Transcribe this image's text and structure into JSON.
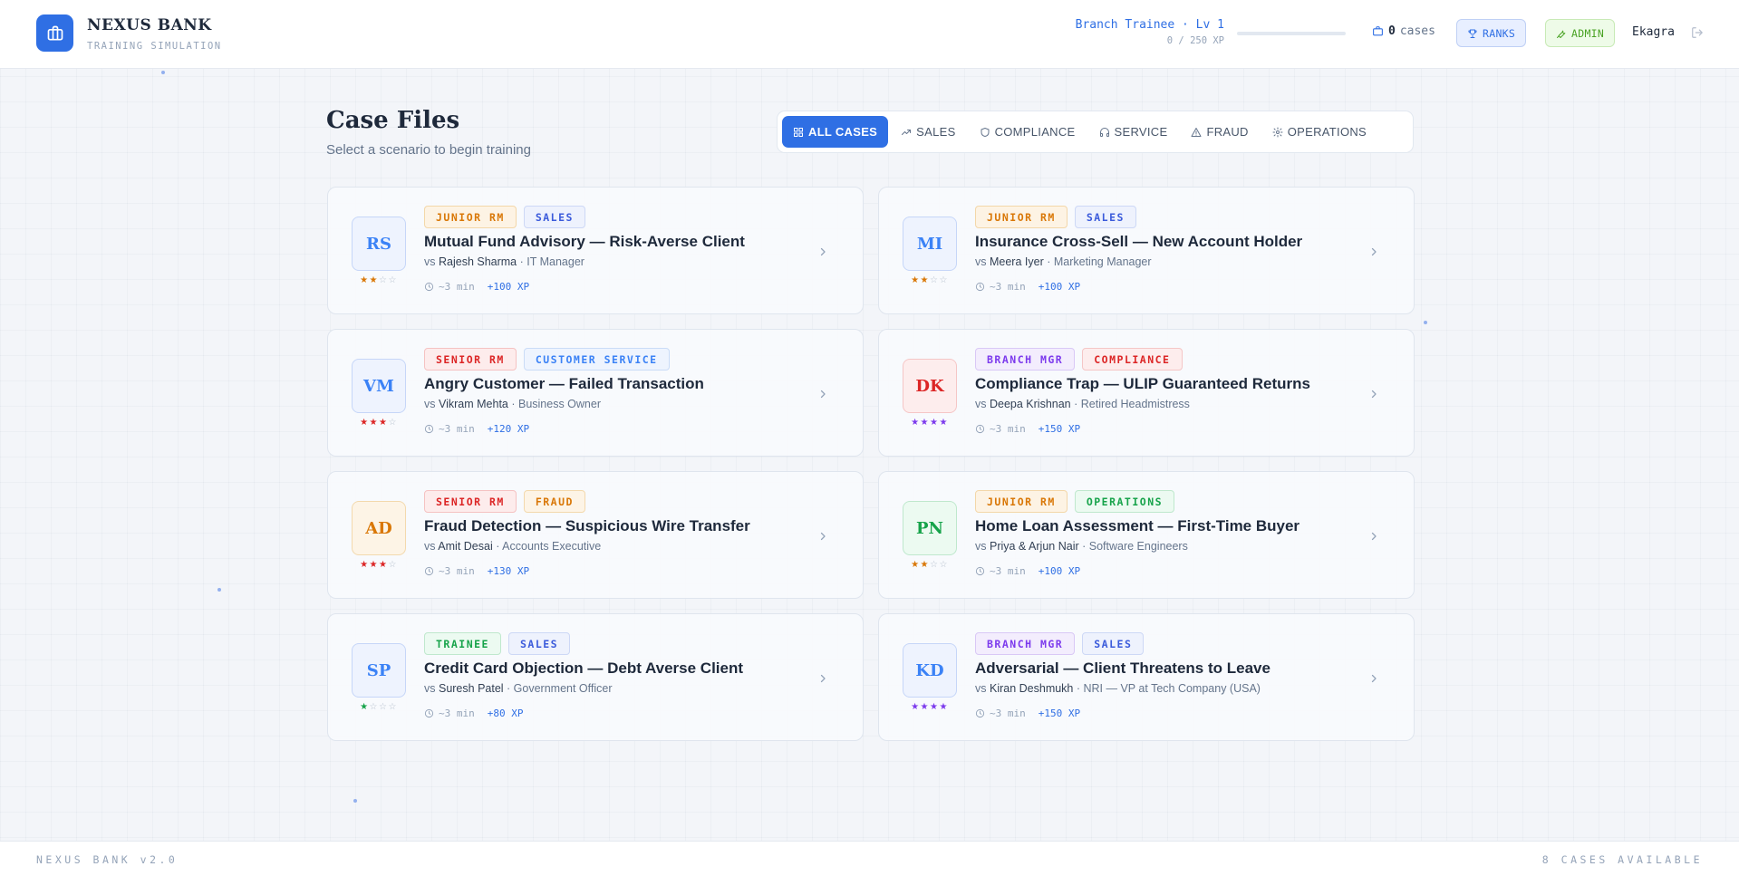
{
  "header": {
    "brand_title": "NEXUS BANK",
    "brand_subtitle": "TRAINING SIMULATION",
    "rank_title": "Branch Trainee · Lv 1",
    "xp_text": "0 / 250 XP",
    "xp_progress_percent": 0,
    "cases_count": "0",
    "cases_label": "cases",
    "ranks_label": "RANKS",
    "admin_label": "ADMIN",
    "user_name": "Ekagra",
    "accent_color": "#2f6fe4"
  },
  "main": {
    "title": "Case Files",
    "subtitle": "Select a scenario to begin training",
    "filters": [
      {
        "label": "ALL CASES",
        "icon": "grid-icon",
        "active": true
      },
      {
        "label": "SALES",
        "icon": "trending-up-icon",
        "active": false
      },
      {
        "label": "COMPLIANCE",
        "icon": "shield-icon",
        "active": false
      },
      {
        "label": "SERVICE",
        "icon": "headphones-icon",
        "active": false
      },
      {
        "label": "FRAUD",
        "icon": "alert-triangle-icon",
        "active": false
      },
      {
        "label": "OPERATIONS",
        "icon": "gear-icon",
        "active": false
      }
    ],
    "cases": [
      {
        "initials": "RS",
        "avatar_color": "#3b82f6",
        "avatar_bg": "#eef3fe",
        "avatar_border": "#c6d6f8",
        "level": "JUNIOR RM",
        "level_color": "#d97706",
        "level_bg": "#fdf3e4",
        "level_border": "#f3d7a9",
        "category": "SALES",
        "category_color": "#3b5bdb",
        "category_bg": "#eef2fd",
        "category_border": "#cdd8f6",
        "title": "Mutual Fund Advisory — Risk-Averse Client",
        "vs": "vs",
        "client": "Rajesh Sharma",
        "role": " · IT Manager",
        "duration": "~3 min",
        "xp": "+100 XP",
        "stars": 2,
        "star_color": "#d97706"
      },
      {
        "initials": "MI",
        "avatar_color": "#3b82f6",
        "avatar_bg": "#eef3fe",
        "avatar_border": "#c6d6f8",
        "level": "JUNIOR RM",
        "level_color": "#d97706",
        "level_bg": "#fdf3e4",
        "level_border": "#f3d7a9",
        "category": "SALES",
        "category_color": "#3b5bdb",
        "category_bg": "#eef2fd",
        "category_border": "#cdd8f6",
        "title": "Insurance Cross-Sell — New Account Holder",
        "vs": "vs",
        "client": "Meera Iyer",
        "role": " · Marketing Manager",
        "duration": "~3 min",
        "xp": "+100 XP",
        "stars": 2,
        "star_color": "#d97706"
      },
      {
        "initials": "VM",
        "avatar_color": "#3b82f6",
        "avatar_bg": "#eef3fe",
        "avatar_border": "#c6d6f8",
        "level": "SENIOR RM",
        "level_color": "#dc2626",
        "level_bg": "#fdecec",
        "level_border": "#f5c2c2",
        "category": "CUSTOMER SERVICE",
        "category_color": "#3b82f6",
        "category_bg": "#eef4fe",
        "category_border": "#cadcf7",
        "title": "Angry Customer — Failed Transaction",
        "vs": "vs",
        "client": "Vikram Mehta",
        "role": " · Business Owner",
        "duration": "~3 min",
        "xp": "+120 XP",
        "stars": 3,
        "star_color": "#dc2626"
      },
      {
        "initials": "DK",
        "avatar_color": "#dc2626",
        "avatar_bg": "#fdeded",
        "avatar_border": "#f5c6c6",
        "level": "BRANCH MGR",
        "level_color": "#7c3aed",
        "level_bg": "#f3edfd",
        "level_border": "#d9c8f6",
        "category": "COMPLIANCE",
        "category_color": "#dc2626",
        "category_bg": "#fdeded",
        "category_border": "#f5c6c6",
        "title": "Compliance Trap — ULIP Guaranteed Returns",
        "vs": "vs",
        "client": "Deepa Krishnan",
        "role": " · Retired Headmistress",
        "duration": "~3 min",
        "xp": "+150 XP",
        "stars": 4,
        "star_color": "#7c3aed"
      },
      {
        "initials": "AD",
        "avatar_color": "#d97706",
        "avatar_bg": "#fdf4e6",
        "avatar_border": "#f3d9ad",
        "level": "SENIOR RM",
        "level_color": "#dc2626",
        "level_bg": "#fdecec",
        "level_border": "#f5c2c2",
        "category": "FRAUD",
        "category_color": "#d97706",
        "category_bg": "#fdf4e6",
        "category_border": "#f3d9ad",
        "title": "Fraud Detection — Suspicious Wire Transfer",
        "vs": "vs",
        "client": "Amit Desai",
        "role": " · Accounts Executive",
        "duration": "~3 min",
        "xp": "+130 XP",
        "stars": 3,
        "star_color": "#dc2626"
      },
      {
        "initials": "PN",
        "avatar_color": "#16a34a",
        "avatar_bg": "#ecfaf1",
        "avatar_border": "#bfe8cd",
        "level": "JUNIOR RM",
        "level_color": "#d97706",
        "level_bg": "#fdf3e4",
        "level_border": "#f3d7a9",
        "category": "OPERATIONS",
        "category_color": "#16a34a",
        "category_bg": "#ecfaf1",
        "category_border": "#bfe8cd",
        "title": "Home Loan Assessment — First-Time Buyer",
        "vs": "vs",
        "client": "Priya & Arjun Nair",
        "role": " · Software Engineers",
        "duration": "~3 min",
        "xp": "+100 XP",
        "stars": 2,
        "star_color": "#d97706"
      },
      {
        "initials": "SP",
        "avatar_color": "#3b82f6",
        "avatar_bg": "#eef3fe",
        "avatar_border": "#c6d6f8",
        "level": "TRAINEE",
        "level_color": "#16a34a",
        "level_bg": "#ecfaf1",
        "level_border": "#bfe8cd",
        "category": "SALES",
        "category_color": "#3b5bdb",
        "category_bg": "#eef2fd",
        "category_border": "#cdd8f6",
        "title": "Credit Card Objection — Debt Averse Client",
        "vs": "vs",
        "client": "Suresh Patel",
        "role": " · Government Officer",
        "duration": "~3 min",
        "xp": "+80 XP",
        "stars": 1,
        "star_color": "#16a34a"
      },
      {
        "initials": "KD",
        "avatar_color": "#3b82f6",
        "avatar_bg": "#eef3fe",
        "avatar_border": "#c6d6f8",
        "level": "BRANCH MGR",
        "level_color": "#7c3aed",
        "level_bg": "#f3edfd",
        "level_border": "#d9c8f6",
        "category": "SALES",
        "category_color": "#3b5bdb",
        "category_bg": "#eef2fd",
        "category_border": "#cdd8f6",
        "title": "Adversarial — Client Threatens to Leave",
        "vs": "vs",
        "client": "Kiran Deshmukh",
        "role": " · NRI — VP at Tech Company (USA)",
        "duration": "~3 min",
        "xp": "+150 XP",
        "stars": 4,
        "star_color": "#7c3aed"
      }
    ]
  },
  "footer": {
    "version": "NEXUS BANK v2.0",
    "available": "8 CASES AVAILABLE"
  }
}
